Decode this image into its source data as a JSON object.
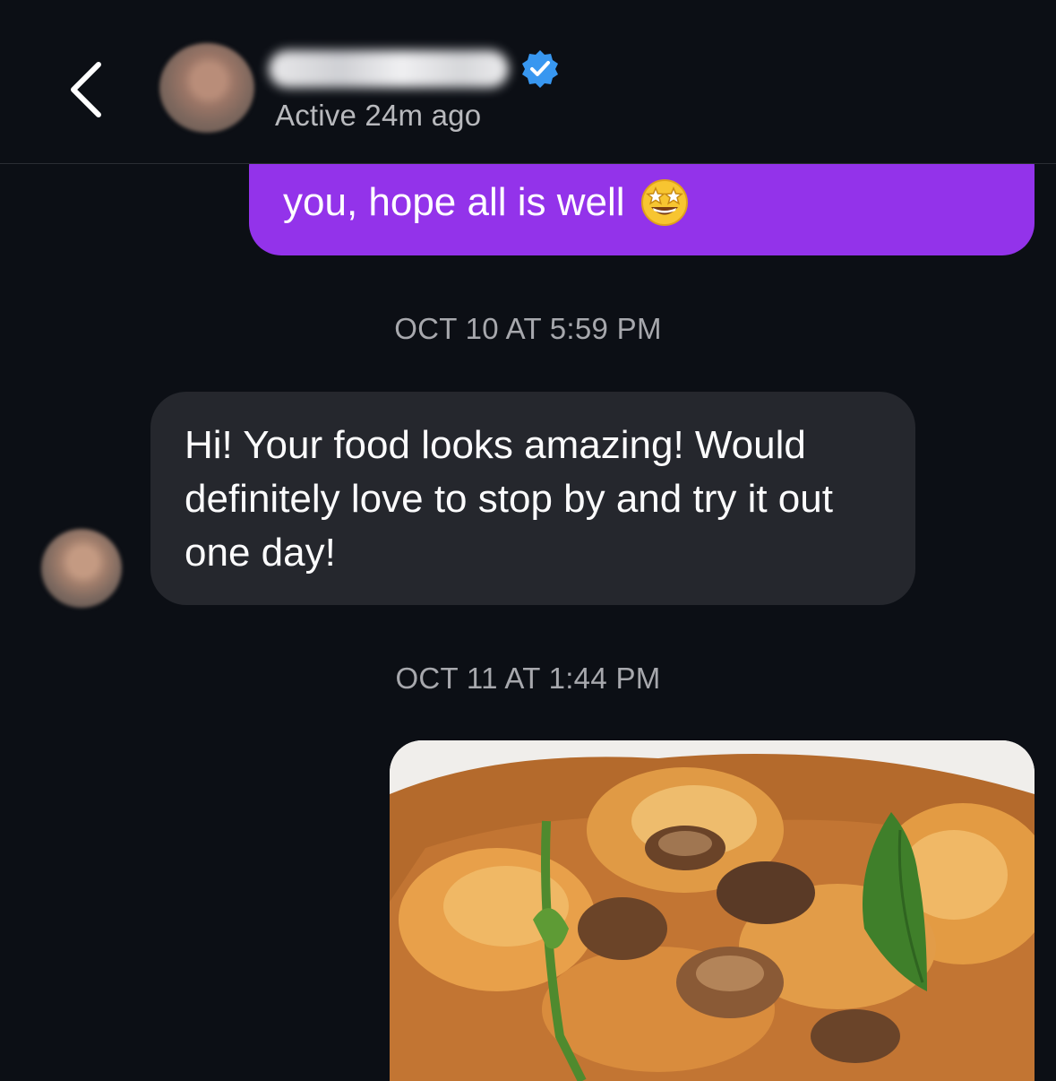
{
  "header": {
    "status": "Active 24m ago",
    "icons": {
      "back": "chevron-left-icon",
      "verified": "verified-badge-icon"
    },
    "accent_color": "#3897f0"
  },
  "messages": {
    "outgoing_first": {
      "last_line": "you, hope all is well",
      "emoji": "star-struck-emoji",
      "bubble_color": "#9333ea"
    },
    "timestamp_1": "OCT 10 AT 5:59 PM",
    "incoming": {
      "text": "Hi! Your food looks amazing! Would definitely love to stop by and try it out one day!",
      "bubble_color": "#25272d"
    },
    "timestamp_2": "OCT 11 AT 1:44 PM",
    "outgoing_photo": {
      "subject": "food-photo"
    }
  }
}
